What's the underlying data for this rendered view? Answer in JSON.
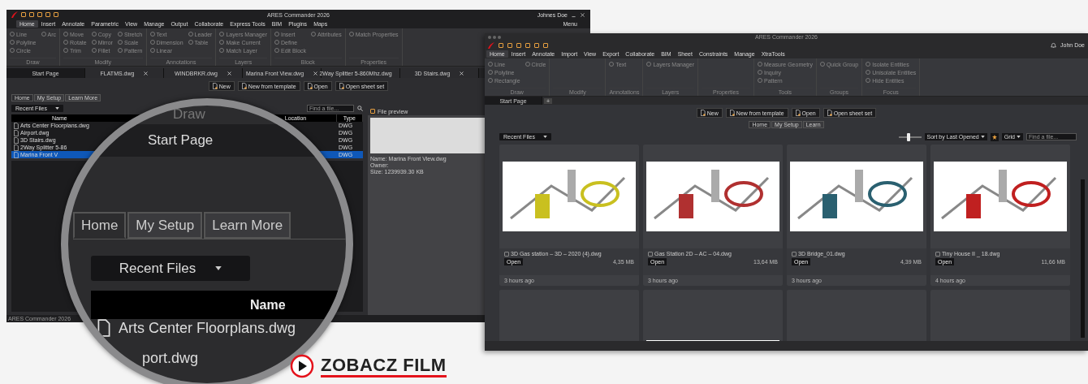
{
  "left_window": {
    "title": "ARES Commander 2026",
    "user": "Johnes Doe",
    "menu_label": "Menu",
    "menu_tabs": [
      {
        "label": "Home",
        "selected": true
      },
      {
        "label": "Insert",
        "selected": false
      },
      {
        "label": "Annotate",
        "selected": false
      },
      {
        "label": "Parametric",
        "selected": false
      },
      {
        "label": "View",
        "selected": false
      },
      {
        "label": "Manage",
        "selected": false
      },
      {
        "label": "Output",
        "selected": false
      },
      {
        "label": "Collaborate",
        "selected": false
      },
      {
        "label": "Express Tools",
        "selected": false
      },
      {
        "label": "BIM",
        "selected": false
      },
      {
        "label": "Plugins",
        "selected": false
      },
      {
        "label": "Maps",
        "selected": false
      }
    ],
    "ribbon_groups": [
      {
        "label": "Draw",
        "tools": [
          "Line",
          "Polyline",
          "Circle",
          "Arc"
        ]
      },
      {
        "label": "Modify",
        "tools": [
          "Move",
          "Rotate",
          "Trim",
          "Copy",
          "Mirror",
          "Fillet",
          "Stretch",
          "Scale",
          "Pattern"
        ]
      },
      {
        "label": "Annotations",
        "tools": [
          "Text",
          "Dimension",
          "Linear",
          "Leader",
          "Table"
        ]
      },
      {
        "label": "Layers",
        "tools": [
          "Layers Manager",
          "Make Current",
          "Match Layer"
        ]
      },
      {
        "label": "Block",
        "tools": [
          "Insert",
          "Define",
          "Edit Block",
          "Attributes"
        ]
      },
      {
        "label": "Properties",
        "tools": [
          "Match Properties"
        ]
      }
    ],
    "doc_tabs": [
      {
        "label": "Start Page",
        "selected": true
      },
      {
        "label": "FLATMS.dwg",
        "selected": false
      },
      {
        "label": "WINDBRKR.dwg",
        "selected": false
      },
      {
        "label": "Marina Front View.dwg",
        "selected": false
      },
      {
        "label": "2Way Splitter 5-860Mhz.dwg",
        "selected": false
      },
      {
        "label": "3D Stairs.dwg",
        "selected": false
      }
    ],
    "actions": [
      "New",
      "New from template",
      "Open",
      "Open sheet set"
    ],
    "page_tabs": [
      {
        "label": "Home",
        "selected": true
      },
      {
        "label": "My Setup",
        "selected": false
      },
      {
        "label": "Learn More",
        "selected": false
      }
    ],
    "file_dropdown": "Recent Files",
    "search": {
      "placeholder": "Find a file..."
    },
    "preview_label": "File preview",
    "table": {
      "columns": [
        "Name",
        "Location",
        "Type"
      ],
      "rows": [
        {
          "name": "Arts Center Floorplans.dwg",
          "type": "DWG",
          "selected": false
        },
        {
          "name": "Airport.dwg",
          "type": "DWG",
          "selected": false
        },
        {
          "name": "3D Stairs.dwg",
          "type": "DWG",
          "selected": false
        },
        {
          "name": "2Way Splitter 5-86",
          "type": "DWG",
          "selected": false
        },
        {
          "name": "Marina Front V",
          "type": "DWG",
          "selected": true
        }
      ]
    },
    "preview_info": [
      "Name: Marina Front View.dwg",
      "Owner:",
      "Size: 1239939.30 KB"
    ],
    "status_bar": "ARES Commander 2026"
  },
  "magnifier": {
    "ribbon_label": "Draw",
    "doc_tab": "Start Page",
    "tabs": [
      {
        "label": "Home",
        "selected": true
      },
      {
        "label": "My Setup",
        "selected": false
      },
      {
        "label": "Learn More",
        "selected": false
      }
    ],
    "dropdown": "Recent Files",
    "column": "Name",
    "rows": [
      "Arts Center Floorplans.dwg",
      "port.dwg"
    ]
  },
  "right_window": {
    "title": "ARES Commander 2026",
    "user": "John Doe",
    "menu_tabs": [
      {
        "label": "Home",
        "selected": true
      },
      {
        "label": "Insert",
        "selected": false
      },
      {
        "label": "Annotate",
        "selected": false
      },
      {
        "label": "Import",
        "selected": false
      },
      {
        "label": "View",
        "selected": false
      },
      {
        "label": "Export",
        "selected": false
      },
      {
        "label": "Collaborate",
        "selected": false
      },
      {
        "label": "BIM",
        "selected": false
      },
      {
        "label": "Sheet",
        "selected": false
      },
      {
        "label": "Constraints",
        "selected": false
      },
      {
        "label": "Manage",
        "selected": false
      },
      {
        "label": "XtraTools",
        "selected": false
      }
    ],
    "ribbon_groups": [
      {
        "label": "Draw",
        "tools": [
          "Line",
          "Polyline",
          "Rectangle",
          "Circle"
        ]
      },
      {
        "label": "Modify"
      },
      {
        "label": "Annotations",
        "tools": [
          "Text"
        ]
      },
      {
        "label": "Layers",
        "tools": [
          "Layers Manager"
        ]
      },
      {
        "label": "Properties"
      },
      {
        "label": "Tools",
        "tools": [
          "Measure Geometry",
          "Inquiry",
          "Pattern"
        ]
      },
      {
        "label": "Groups",
        "tools": [
          "Quick Group"
        ]
      },
      {
        "label": "Focus",
        "tools": [
          "Isolate Entities",
          "Unisolate Entities",
          "Hide Entities"
        ]
      }
    ],
    "doc_tabs": [
      {
        "label": "Start Page",
        "selected": true
      }
    ],
    "new_tab": "+",
    "actions": [
      "New",
      "New from template",
      "Open",
      "Open sheet set"
    ],
    "page_tabs": [
      {
        "label": "Home",
        "selected": true
      },
      {
        "label": "My Setup",
        "selected": false
      },
      {
        "label": "Learn",
        "selected": false
      }
    ],
    "file_dropdown": "Recent Files",
    "zoom_slider": {
      "level": 0.45
    },
    "sort": "Sort by Last Opened",
    "view": "Grid",
    "search": {
      "placeholder": "Find a file..."
    },
    "cards": [
      {
        "name": "3D Gas station – 3D – 2020 (4).dwg",
        "button": "Open",
        "size": "4,35 MB",
        "time": "3 hours ago"
      },
      {
        "name": "Gas Station 2D – AC – 04.dwg",
        "button": "Open",
        "size": "13,64 MB",
        "time": "3 hours ago"
      },
      {
        "name": "3D Bridge_01.dwg",
        "button": "Open",
        "size": "4,39 MB",
        "time": "3 hours ago"
      },
      {
        "name": "Tiny House II _ 18.dwg",
        "button": "Open",
        "size": "11,66 MB",
        "time": "4 hours ago"
      }
    ],
    "partial_cards": [
      {
        "kind": "dark"
      },
      {
        "kind": "light"
      },
      {
        "kind": "empty"
      },
      {
        "kind": "empty"
      }
    ]
  },
  "video_link": {
    "label": "ZOBACZ FILM"
  }
}
